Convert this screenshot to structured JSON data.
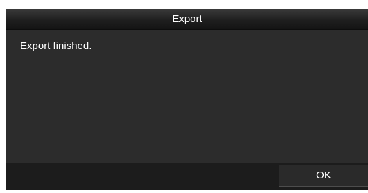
{
  "dialog": {
    "title": "Export",
    "message": "Export finished.",
    "ok_label": "OK"
  }
}
